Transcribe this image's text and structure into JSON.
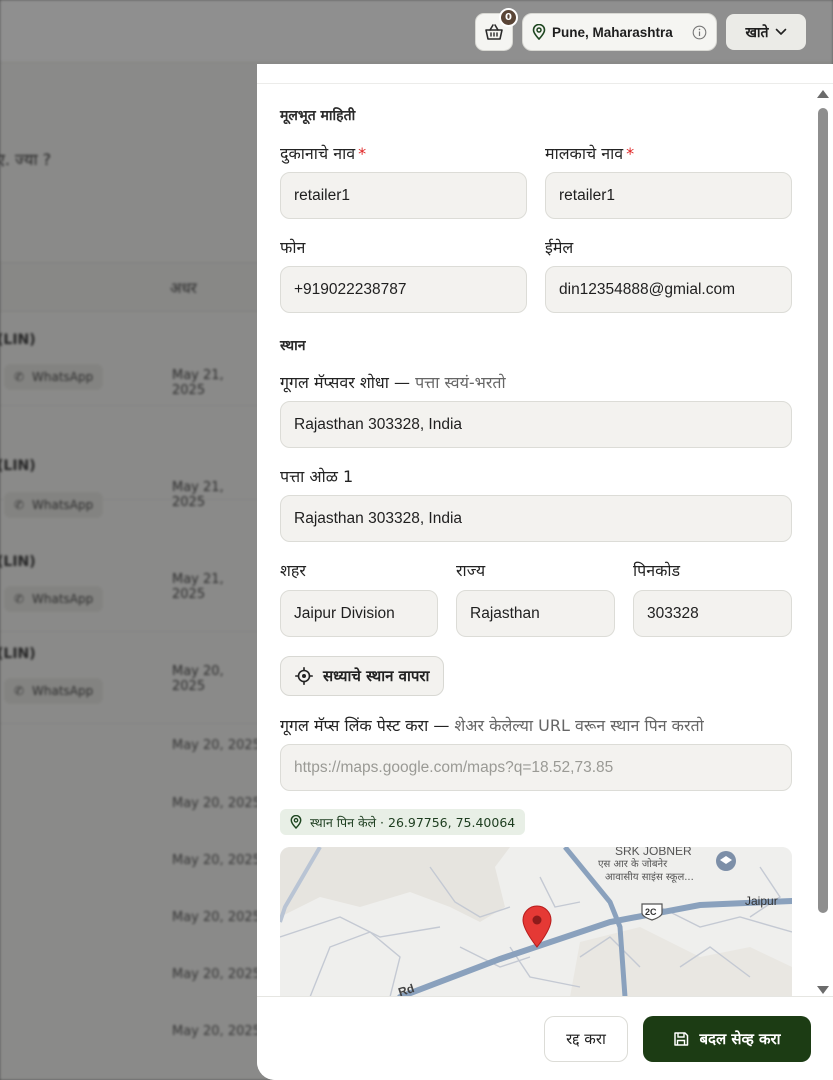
{
  "background": {
    "question_text": "ए. ज्या ?",
    "table_head": "अधर",
    "rows": [
      {
        "name": "(LIN)",
        "badge": "WhatsApp",
        "date": "May 21, 2025"
      },
      {
        "name": "(LIN)",
        "badge": "WhatsApp",
        "date": "May 21, 2025"
      },
      {
        "name": "(LIN)",
        "badge": "WhatsApp",
        "date": "May 21, 2025"
      },
      {
        "name": "(LIN)",
        "badge": "WhatsApp",
        "date": "May 20, 2025"
      }
    ],
    "dates": [
      "May 20, 2025",
      "May 20, 2025",
      "May 20, 2025",
      "May 20, 2025",
      "May 20, 2025",
      "May 20, 2025"
    ]
  },
  "header": {
    "cart_count": "0",
    "location": "Pune, Maharashtra",
    "account_label": "खाते"
  },
  "form": {
    "basic_section": "मूलभूत माहिती",
    "shop_name_label": "दुकानाचे नाव",
    "shop_name_value": "retailer1",
    "owner_name_label": "मालकाचे नाव",
    "owner_name_value": "retailer1",
    "required_mark": "*",
    "phone_label": "फोन",
    "phone_value": "+919022238787",
    "email_label": "ईमेल",
    "email_value": "din12354888@gmial.com",
    "location_section": "स्थान",
    "search_label_main": "गूगल मॅप्सवर शोधा —",
    "search_label_hint": " पत्ता स्वयं-भरतो",
    "search_value": "Rajasthan 303328, India",
    "address1_label": "पत्ता ओळ 1",
    "address1_value": "Rajasthan 303328, India",
    "city_label": "शहर",
    "city_value": "Jaipur Division",
    "state_label": "राज्य",
    "state_value": "Rajasthan",
    "pincode_label": "पिनकोड",
    "pincode_value": "303328",
    "use_location_button": "सध्याचे स्थान वापरा",
    "maps_link_label_main": "गूगल मॅप्स लिंक पेस्ट करा —",
    "maps_link_label_hint": " शेअर केलेल्या URL वरून स्थान पिन करतो",
    "maps_link_placeholder": "https://maps.google.com/maps?q=18.52,73.85",
    "pinned_text": "स्थान पिन केले · 26.97756, 75.40064"
  },
  "map": {
    "poi_title": "SRK JOBNER",
    "poi_sub1": "एस आर के जोबनेर",
    "poi_sub2": "आवासीय साइंस स्कूल...",
    "road_label_1": "Jaipur",
    "road_label_2": "Rd",
    "highway_shield": "2C"
  },
  "footer": {
    "cancel_label": "रद्द करा",
    "save_label": "बदल सेव्ह करा"
  }
}
